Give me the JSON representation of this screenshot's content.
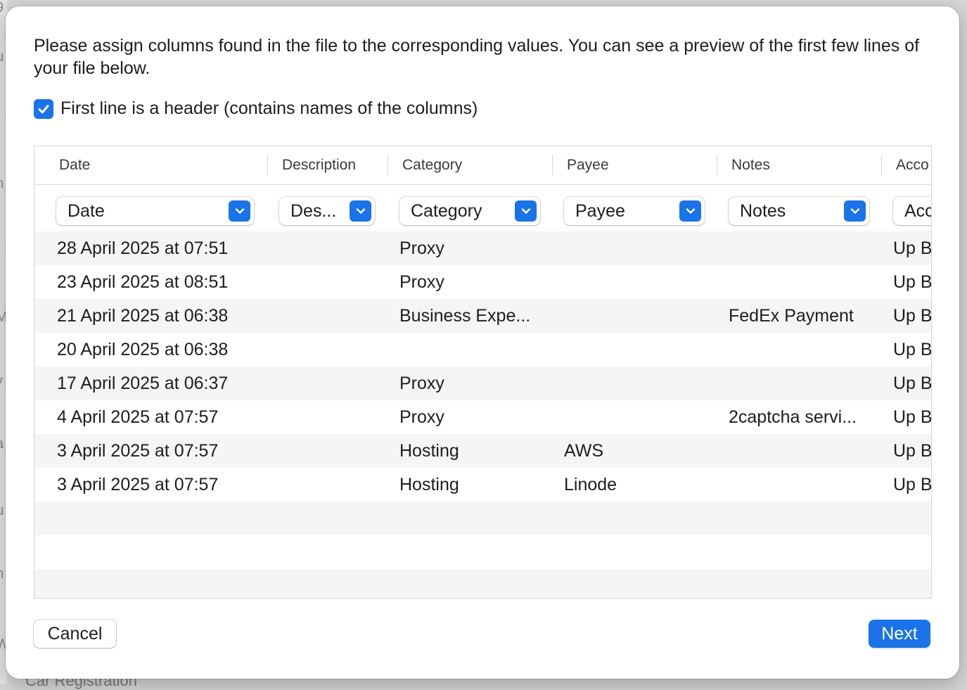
{
  "dialog": {
    "intro": "Please assign columns found in the file to the corresponding values. You can see a preview of the first few lines of your file below.",
    "header_checkbox": {
      "label": "First line is a header (contains names of the columns)",
      "checked": true
    }
  },
  "table": {
    "headers": [
      "Date",
      "Description",
      "Category",
      "Payee",
      "Notes",
      "Acco"
    ],
    "mappings": [
      "Date",
      "Des...",
      "Category",
      "Payee",
      "Notes",
      "Acc"
    ],
    "rows": [
      [
        "28 April 2025 at 07:51",
        "",
        "Proxy",
        "",
        "",
        "Up B"
      ],
      [
        "23 April 2025 at 08:51",
        "",
        "Proxy",
        "",
        "",
        "Up B"
      ],
      [
        "21 April 2025 at 06:38",
        "",
        "Business Expe...",
        "",
        "FedEx Payment",
        "Up B"
      ],
      [
        "20 April 2025 at 06:38",
        "",
        "",
        "",
        "",
        "Up B"
      ],
      [
        "17 April 2025 at 06:37",
        "",
        "Proxy",
        "",
        "",
        "Up B"
      ],
      [
        "4 April 2025 at 07:57",
        "",
        "Proxy",
        "",
        "2captcha servi...",
        "Up B"
      ],
      [
        "3 April 2025 at 07:57",
        "",
        "Hosting",
        "AWS",
        "",
        "Up B"
      ],
      [
        "3 April 2025 at 07:57",
        "",
        "Hosting",
        "Linode",
        "",
        "Up B"
      ]
    ]
  },
  "buttons": {
    "cancel": "Cancel",
    "next": "Next"
  },
  "background": {
    "bottom_text": "Car Registration"
  },
  "colors": {
    "accent": "#1a73e8",
    "row_alt": "#f4f5f5"
  }
}
